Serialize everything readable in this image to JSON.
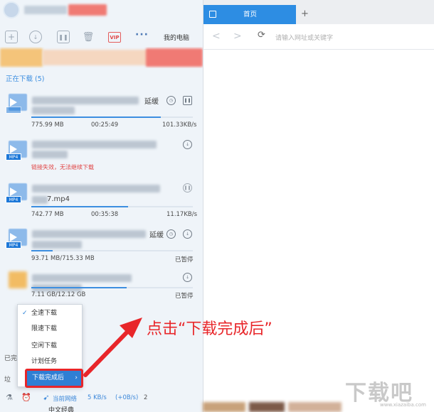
{
  "toolbar": {
    "vip_label": "VIP",
    "more_label": "···",
    "my_computer_label": "我的电脑"
  },
  "section": {
    "downloading_label": "正在下载 (5)"
  },
  "items": [
    {
      "name_suffix": "",
      "status_right": "延缓",
      "size": "775.99 MB",
      "time": "00:25:49",
      "speed": "101.33KB/s",
      "progress": 0.8
    },
    {
      "file_tag": "MP4",
      "error": "链接失效，无法继续下载",
      "progress": 0.0
    },
    {
      "file_tag": "MP4",
      "name_suffix": "7.mp4",
      "size": "742.77 MB",
      "time": "00:35:38",
      "speed": "11.17KB/s",
      "progress": 0.6
    },
    {
      "file_tag": "MP4",
      "status_right": "延缓",
      "size": "93.71 MB/715.33 MB",
      "state": "已暂停",
      "progress": 0.13
    },
    {
      "size": "7.11 GB/12.12 GB",
      "state": "已暂停",
      "progress": 0.59
    }
  ],
  "menu": {
    "items": [
      {
        "label": "全速下载",
        "checked": true
      },
      {
        "label": "限速下载"
      },
      {
        "label": "空闲下载"
      },
      {
        "label": "计划任务"
      },
      {
        "label": "下载完成后",
        "active": true
      }
    ]
  },
  "status": {
    "side_label_1": "已完",
    "side_label_2": "垃",
    "network_label": "当前网络",
    "speed_text": "5 KB/s",
    "speed_extra": "(+0B/s)",
    "extra_digit": "2"
  },
  "browser": {
    "tab_label": "首页",
    "new_tab": "+",
    "back": "<",
    "forward": ">",
    "refresh": "C",
    "address_placeholder": "请输入网址或关键字"
  },
  "annotation": {
    "text": "点击“下载完成后”"
  },
  "footer": {
    "text": "中文经典"
  },
  "watermark": {
    "text": "下载吧",
    "sub": "www.xiazaiba.com"
  },
  "colors": {
    "accent": "#2d8de3",
    "annotation_red": "#e8262a",
    "error_red": "#e04444"
  }
}
